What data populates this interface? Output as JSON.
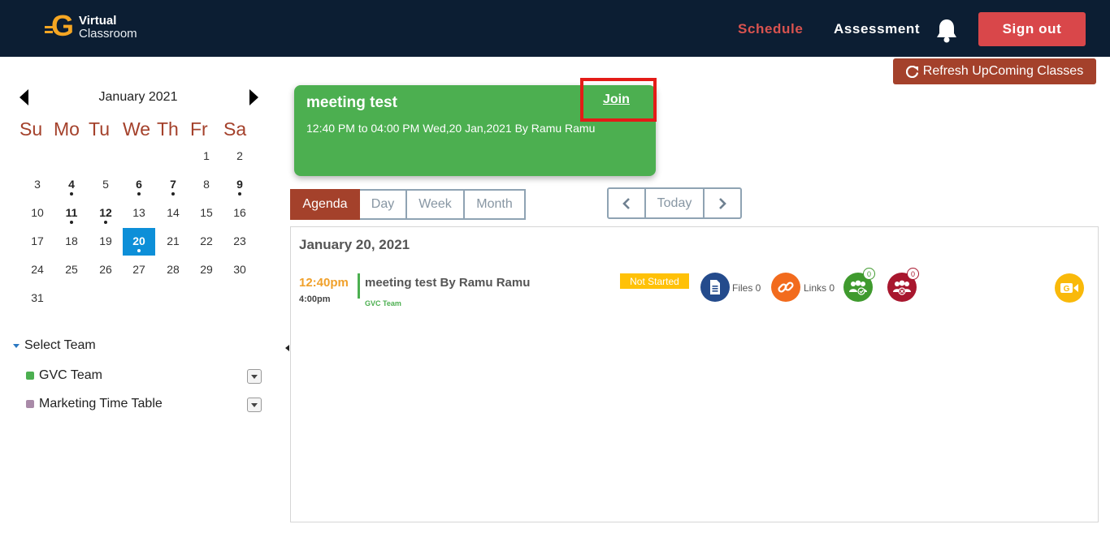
{
  "header": {
    "logo_line1": "Virtual",
    "logo_line2": "Classroom",
    "nav_schedule": "Schedule",
    "nav_assessment": "Assessment",
    "signout_label": "Sign out"
  },
  "refresh_label": "Refresh UpComing Classes",
  "calendar": {
    "month_title": "January 2021",
    "weekdays": [
      "Su",
      "Mo",
      "Tu",
      "We",
      "Th",
      "Fr",
      "Sa"
    ],
    "weeks": [
      [
        "",
        "",
        "",
        "",
        "",
        "1",
        "2"
      ],
      [
        "3",
        "4",
        "5",
        "6",
        "7",
        "8",
        "9"
      ],
      [
        "10",
        "11",
        "12",
        "13",
        "14",
        "15",
        "16"
      ],
      [
        "17",
        "18",
        "19",
        "20",
        "21",
        "22",
        "23"
      ],
      [
        "24",
        "25",
        "26",
        "27",
        "28",
        "29",
        "30"
      ],
      [
        "31",
        "",
        "",
        "",
        "",
        "",
        ""
      ]
    ],
    "event_days": [
      "4",
      "6",
      "7",
      "9",
      "11",
      "12",
      "20"
    ],
    "selected_day": "20"
  },
  "teams": {
    "heading": "Select Team",
    "items": [
      {
        "name": "GVC Team",
        "color": "#4caf50"
      },
      {
        "name": "Marketing Time Table",
        "color": "#a98aa8"
      }
    ]
  },
  "upcoming": {
    "title": "meeting test",
    "time_line": "12:40 PM to 04:00 PM Wed,20 Jan,2021 By Ramu Ramu",
    "join_label": "Join"
  },
  "view_tabs": [
    "Agenda",
    "Day",
    "Week",
    "Month"
  ],
  "active_view": "Agenda",
  "nav": {
    "today_label": "Today"
  },
  "agenda": {
    "date_heading": "January 20, 2021",
    "event": {
      "start": "12:40pm",
      "end": "4:00pm",
      "title": "meeting test By Ramu Ramu",
      "team": "GVC Team",
      "status": "Not Started",
      "files_label": "Files 0",
      "links_label": "Links 0",
      "attended_count": "0",
      "absent_count": "0"
    }
  },
  "colors": {
    "header_bg": "#0c1e33",
    "accent": "#a4412b",
    "signout": "#d9474a",
    "card": "#4caf50",
    "selected_day": "#0d8fd8"
  }
}
